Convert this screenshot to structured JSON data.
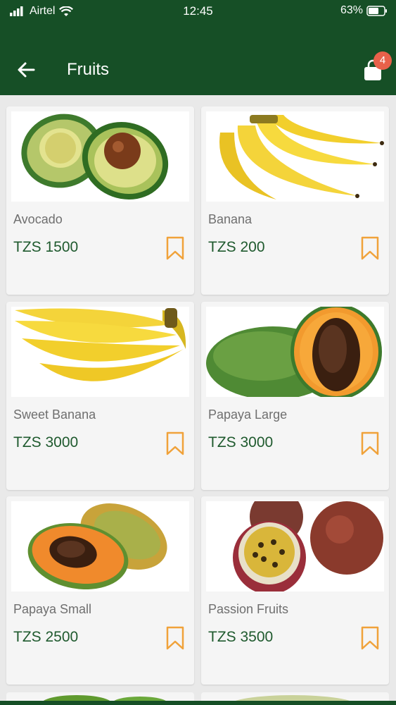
{
  "status": {
    "carrier": "Airtel",
    "time": "12:45",
    "battery": "63%"
  },
  "header": {
    "title": "Fruits",
    "back_icon": "arrow-left-icon",
    "cart_icon": "shopping-bag-icon",
    "cart_count": "4"
  },
  "colors": {
    "primary": "#164f26",
    "price": "#1f5a2e",
    "accent": "#f0a23a",
    "badge": "#e8614a",
    "background": "#e9e9e9"
  },
  "products": [
    {
      "name": "Avocado",
      "price": "TZS 1500",
      "icon": "avocado-image"
    },
    {
      "name": "Banana",
      "price": "TZS 200",
      "icon": "banana-image"
    },
    {
      "name": "Sweet Banana",
      "price": "TZS 3000",
      "icon": "sweet-banana-image"
    },
    {
      "name": "Papaya Large",
      "price": "TZS 3000",
      "icon": "papaya-large-image"
    },
    {
      "name": "Papaya Small",
      "price": "TZS 2500",
      "icon": "papaya-small-image"
    },
    {
      "name": "Passion Fruits",
      "price": "TZS 3500",
      "icon": "passion-fruit-image"
    }
  ]
}
